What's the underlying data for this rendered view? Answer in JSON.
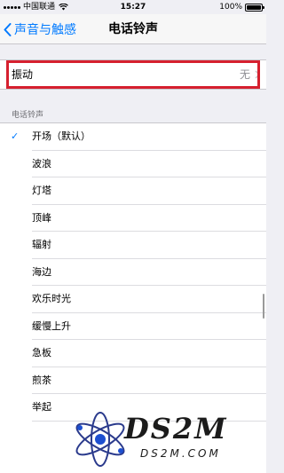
{
  "status_bar": {
    "carrier": "中国联通",
    "time": "15:27",
    "battery": "100%"
  },
  "nav": {
    "back_label": "声音与触感",
    "title": "电话铃声"
  },
  "vibration": {
    "label": "振动",
    "value": "无"
  },
  "section_header": "电话铃声",
  "ringtones": [
    {
      "name": "开场（默认）",
      "selected": true
    },
    {
      "name": "波浪"
    },
    {
      "name": "灯塔"
    },
    {
      "name": "顶峰"
    },
    {
      "name": "辐射"
    },
    {
      "name": "海边"
    },
    {
      "name": "欢乐时光"
    },
    {
      "name": "缓慢上升"
    },
    {
      "name": "急板"
    },
    {
      "name": "煎茶"
    },
    {
      "name": "举起"
    }
  ],
  "watermark": {
    "title": "DS2M",
    "subtitle": "DS2M.COM"
  },
  "colors": {
    "accent": "#007aff",
    "highlight": "#d6202f",
    "background": "#efeff4"
  }
}
